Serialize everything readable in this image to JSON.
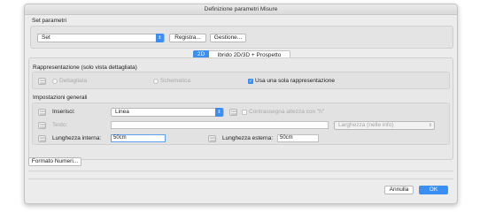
{
  "window": {
    "title": "Definizione parametri Misure"
  },
  "set_section": {
    "heading": "Set parametri",
    "set_value": "Set",
    "registra_label": "Registra...",
    "gestione_label": "Gestione..."
  },
  "tabs": [
    {
      "label": "2D"
    },
    {
      "label": "Ibrido 2D/3D + Prospetto"
    }
  ],
  "rappresentazione": {
    "heading": "Rappresentazione (solo vista dettagliata)",
    "option_dettagliata": "Dettagliata",
    "option_schematica": "Schematica",
    "checkbox_label": "Usa una sola rappresentazione"
  },
  "impostazioni": {
    "heading": "Impostazioni generali",
    "inserisci_label": "Inserisci:",
    "inserisci_value": "Linea",
    "contrassegna_label": "Contrassegna altezza con \"h\"",
    "testo_label": "Testo:",
    "testo_value": "",
    "larghezza_value": "Larghezza (nelle info)",
    "lunghezza_interna_label": "Lunghezza interna:",
    "lunghezza_interna_value": "50cm",
    "lunghezza_esterna_label": "Lunghezza esterna:",
    "lunghezza_esterna_value": "50cm"
  },
  "formato_button": "Formato Numeri...",
  "footer": {
    "annulla_label": "Annulla",
    "ok_label": "OK"
  },
  "colors": {
    "accent": "#3b8ff2",
    "window_bg": "#ececec",
    "panel_bg": "#e4e4e4"
  }
}
